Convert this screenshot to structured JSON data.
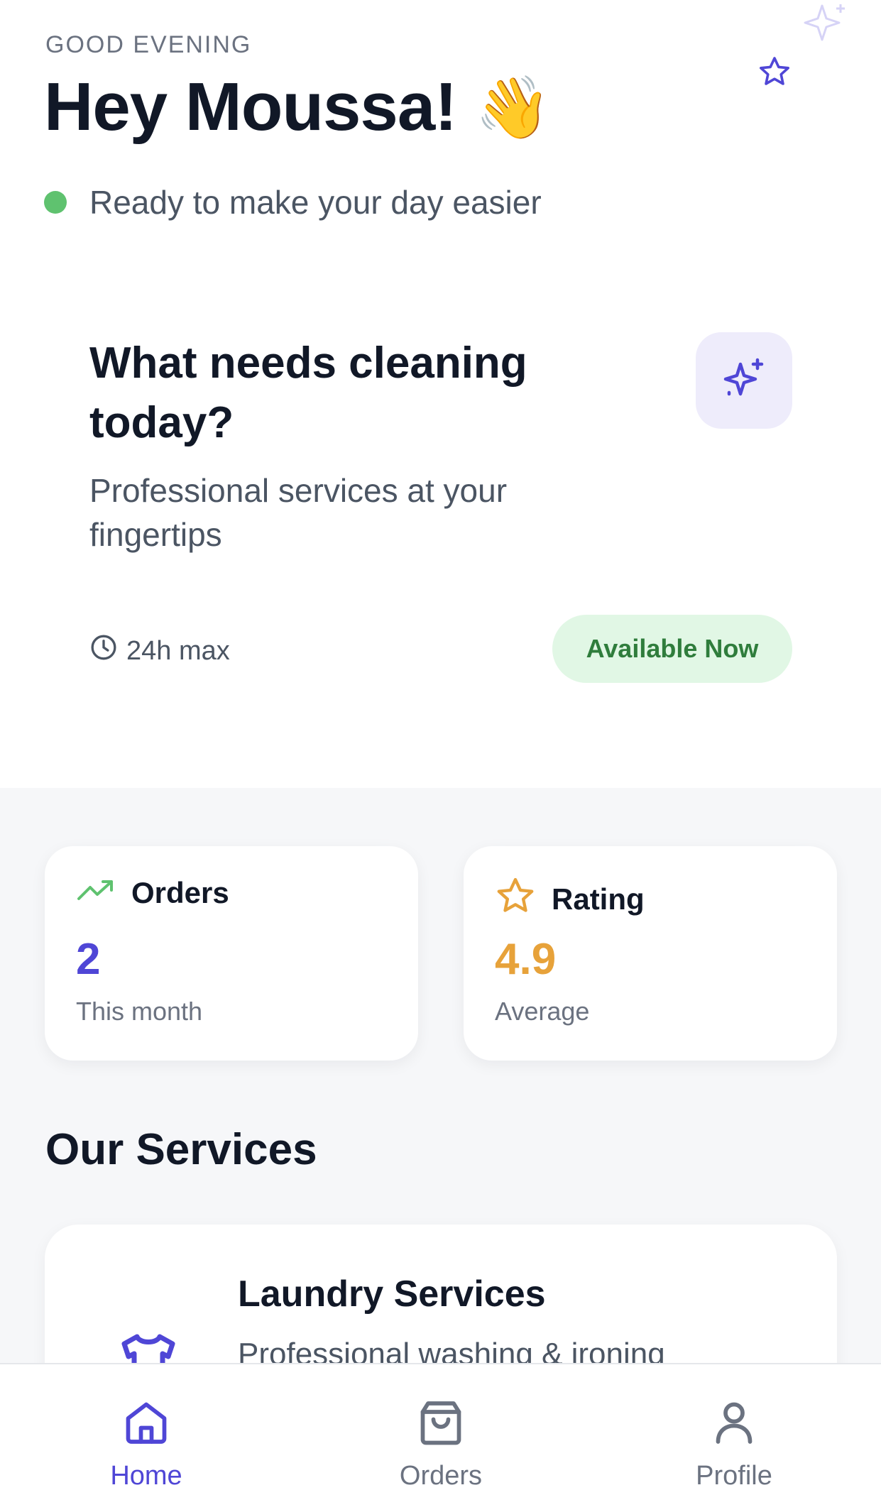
{
  "header": {
    "greeting_small": "GOOD EVENING",
    "greeting_big": "Hey Moussa!",
    "wave_emoji": "👋",
    "status_text": "Ready to make your day easier",
    "status_color": "#5fc26f"
  },
  "hero_card": {
    "title": "What needs cleaning today?",
    "subtitle": "Professional services at your fingertips",
    "time_label": "24h max",
    "availability_label": "Available Now",
    "icon": "sparkle-icon"
  },
  "stats": [
    {
      "label": "Orders",
      "value": "2",
      "caption": "This month",
      "icon": "trending-up-icon",
      "value_color": "#4f46d6"
    },
    {
      "label": "Rating",
      "value": "4.9",
      "caption": "Average",
      "icon": "star-icon",
      "value_color": "#e7a23a"
    }
  ],
  "services": {
    "section_title": "Our Services",
    "items": [
      {
        "title": "Laundry Services",
        "description": "Professional washing & ironing",
        "icon": "shirt-icon"
      }
    ]
  },
  "bottom_nav": {
    "items": [
      {
        "label": "Home",
        "icon": "home-icon",
        "active": true
      },
      {
        "label": "Orders",
        "icon": "bag-icon",
        "active": false
      },
      {
        "label": "Profile",
        "icon": "user-icon",
        "active": false
      }
    ]
  },
  "colors": {
    "accent": "#4f46d6",
    "success_bg": "#e1f7e5",
    "success_text": "#2f7d3c",
    "rating": "#e7a23a"
  }
}
